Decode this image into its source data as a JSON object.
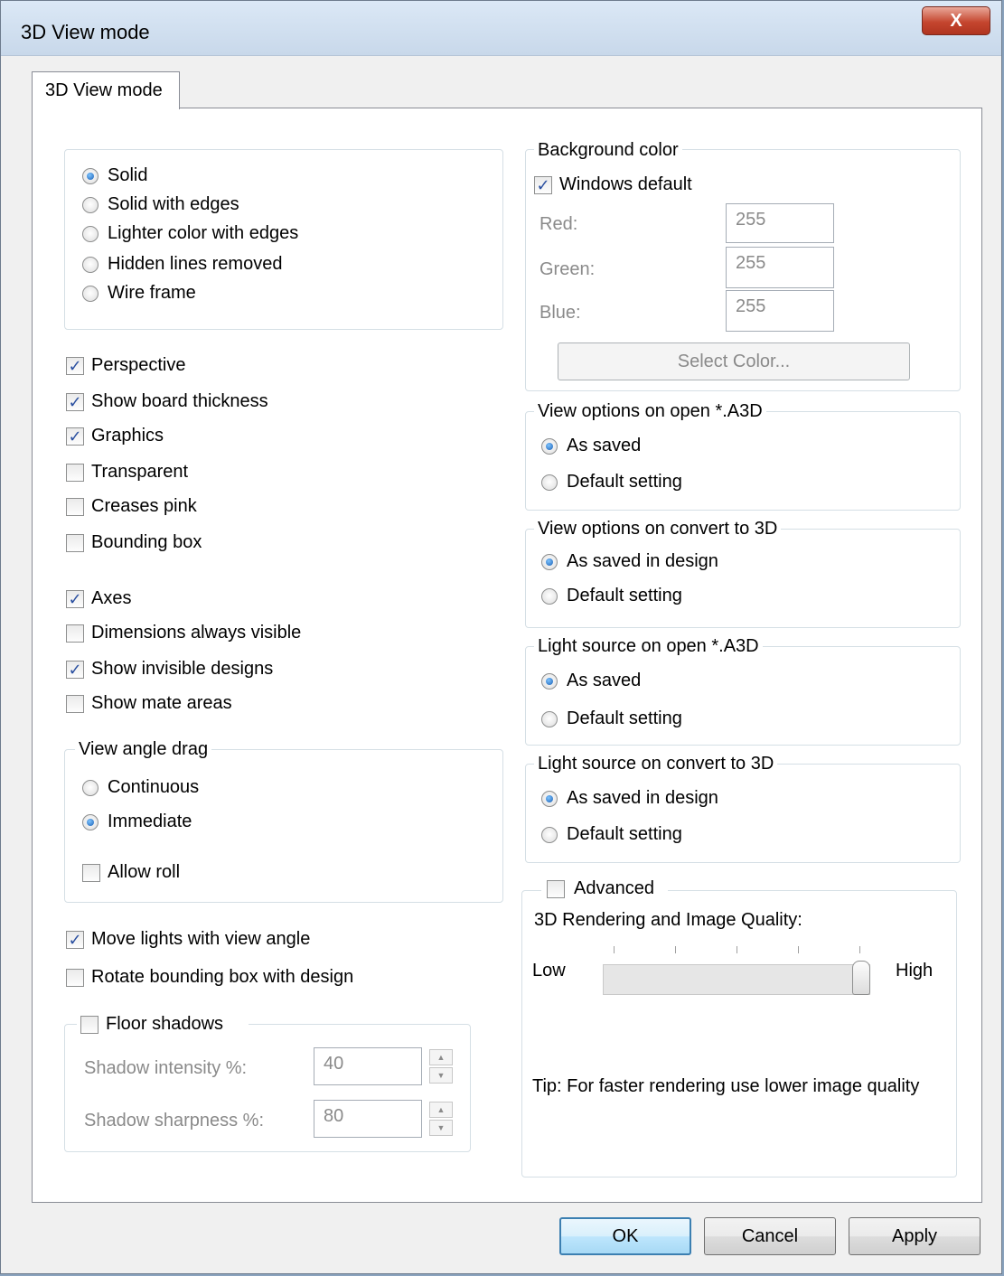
{
  "window": {
    "title": "3D View mode",
    "close_label": "X"
  },
  "tab": {
    "label": "3D View mode"
  },
  "render_mode": {
    "options": [
      "Solid",
      "Solid with edges",
      "Lighter color with edges",
      "Hidden lines removed",
      "Wire frame"
    ],
    "selected": "Solid"
  },
  "checks_a": [
    {
      "label": "Perspective",
      "checked": true
    },
    {
      "label": "Show board thickness",
      "checked": true
    },
    {
      "label": "Graphics",
      "checked": true
    },
    {
      "label": "Transparent",
      "checked": false
    },
    {
      "label": "Creases pink",
      "checked": false
    },
    {
      "label": "Bounding box",
      "checked": false
    }
  ],
  "checks_b": [
    {
      "label": "Axes",
      "checked": true
    },
    {
      "label": "Dimensions always visible",
      "checked": false
    },
    {
      "label": "Show invisible designs",
      "checked": true
    },
    {
      "label": "Show mate areas",
      "checked": false
    }
  ],
  "view_angle_drag": {
    "title": "View angle drag",
    "options": [
      "Continuous",
      "Immediate"
    ],
    "selected": "Immediate",
    "allow_roll": {
      "label": "Allow roll",
      "checked": false
    }
  },
  "checks_c": [
    {
      "label": "Move lights with view angle",
      "checked": true
    },
    {
      "label": "Rotate bounding box with design",
      "checked": false
    }
  ],
  "floor_shadows": {
    "label": "Floor shadows",
    "checked": false,
    "intensity_label": "Shadow intensity %:",
    "intensity_value": "40",
    "sharpness_label": "Shadow sharpness %:",
    "sharpness_value": "80"
  },
  "background_color": {
    "title": "Background color",
    "windows_default": {
      "label": "Windows default",
      "checked": true
    },
    "red_label": "Red:",
    "red_value": "255",
    "green_label": "Green:",
    "green_value": "255",
    "blue_label": "Blue:",
    "blue_value": "255",
    "select_button": "Select Color..."
  },
  "view_open": {
    "title": "View options on open *.A3D",
    "options": [
      "As saved",
      "Default setting"
    ],
    "selected": "As saved"
  },
  "view_convert": {
    "title": "View options on convert to 3D",
    "options": [
      "As saved in design",
      "Default setting"
    ],
    "selected": "As saved in design"
  },
  "light_open": {
    "title": "Light source on open *.A3D",
    "options": [
      "As saved",
      "Default setting"
    ],
    "selected": "As saved"
  },
  "light_convert": {
    "title": "Light source on convert to 3D",
    "options": [
      "As saved in design",
      "Default setting"
    ],
    "selected": "As saved in design"
  },
  "advanced": {
    "label": "Advanced",
    "checked": false,
    "quality_label": "3D Rendering and Image Quality:",
    "low_label": "Low",
    "high_label": "High",
    "quality_level": 1.0,
    "tip": "Tip: For faster rendering use lower image quality"
  },
  "buttons": {
    "ok": "OK",
    "cancel": "Cancel",
    "apply": "Apply"
  },
  "colors": {
    "accent": "#3c7fb1",
    "checkmark": "#2a4fa0",
    "close": "#c5462f"
  }
}
